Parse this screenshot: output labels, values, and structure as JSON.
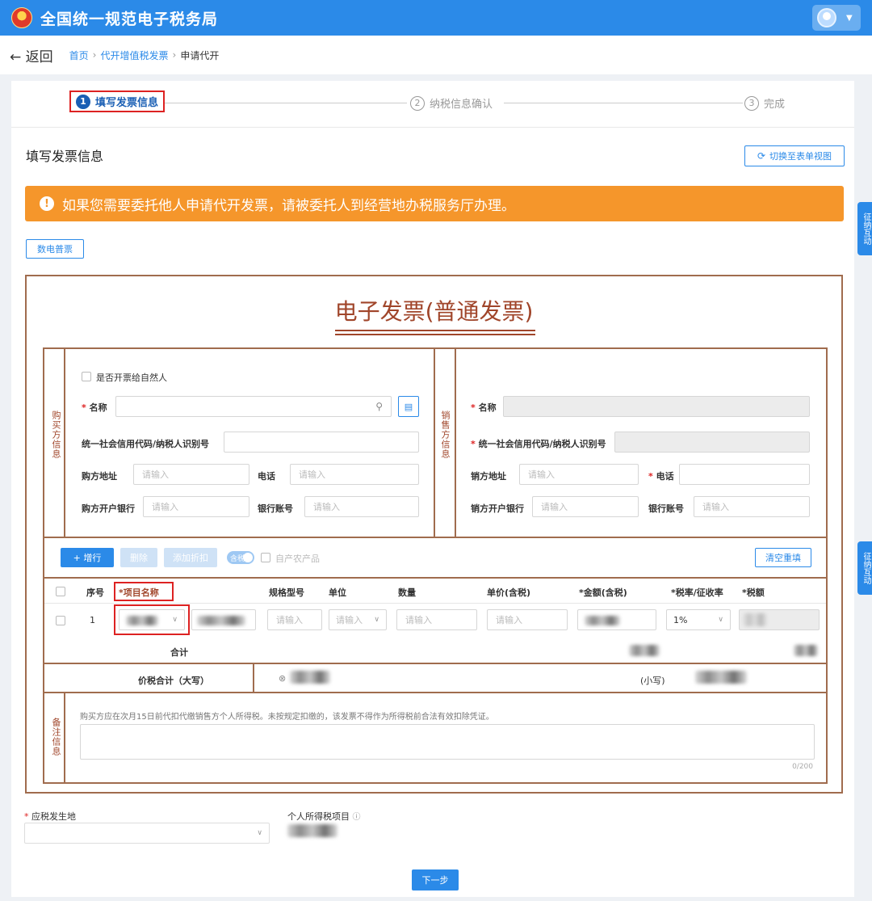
{
  "header": {
    "title": "全国统一规范电子税务局"
  },
  "nav": {
    "back": "← 返回",
    "crumbs": [
      "首页",
      "代开增值税发票",
      "申请代开"
    ],
    "sep": "›"
  },
  "steps": [
    {
      "num": "1",
      "label": "填写发票信息"
    },
    {
      "num": "2",
      "label": "纳税信息确认"
    },
    {
      "num": "3",
      "label": "完成"
    }
  ],
  "section": {
    "title": "填写发票信息",
    "switch_label": "切换至表单视图",
    "switch_icon": "refresh-icon"
  },
  "notice": {
    "icon": "info-icon",
    "text": "如果您需要委托他人申请代开发票，请被委托人到经营地办税服务厅办理。"
  },
  "invoice_type": "数电普票",
  "side_tabs": [
    "征纳互动",
    "征纳互动"
  ],
  "invoice": {
    "title": "电子发票(普通发票)",
    "buyer": {
      "section_label": "购买方信息",
      "checkbox_label": "是否开票给自然人",
      "name_label": "名称",
      "tax_id_label": "统一社会信用代码/纳税人识别号",
      "address_label": "购方地址",
      "address_placeholder": "请输入",
      "phone_label": "电话",
      "phone_placeholder": "请输入",
      "bank_label": "购方开户银行",
      "bank_placeholder": "请输入",
      "account_label": "银行账号",
      "account_placeholder": "请输入"
    },
    "seller": {
      "section_label": "销售方信息",
      "name_label": "名称",
      "tax_id_label": "统一社会信用代码/纳税人识别号",
      "address_label": "销方地址",
      "address_placeholder": "请输入",
      "phone_label": "电话",
      "bank_label": "销方开户银行",
      "bank_placeholder": "请输入",
      "account_label": "银行账号",
      "account_placeholder": "请输入"
    },
    "toolbar": {
      "add_row": "+ 增行",
      "delete": "删除",
      "add_discount": "添加折扣",
      "toggle_label": "含税",
      "self_produced": "自产农产品",
      "clear": "清空重填"
    },
    "columns": [
      "序号",
      "*项目名称",
      "规格型号",
      "单位",
      "数量",
      "单价(含税)",
      "*金额(含税)",
      "*税率/征收率",
      "*税额"
    ],
    "row": {
      "index": "1",
      "spec_placeholder": "请输入",
      "unit_placeholder": "请输入",
      "qty_placeholder": "请输入",
      "price_placeholder": "请输入",
      "tax_rate": "1%"
    },
    "total_label": "合计",
    "price_tax_total_label": "价税合计（大写）",
    "small_label": "(小写)",
    "remark": {
      "section_label": "备注信息",
      "text": "购买方应在次月15日前代扣代缴销售方个人所得税。未按规定扣缴的，该发票不得作为所得税前合法有效扣除凭证。",
      "counter": "0/200"
    }
  },
  "bottom": {
    "tax_location_label": "应税发生地",
    "income_item_label": "个人所得税项目",
    "next": "下一步"
  }
}
